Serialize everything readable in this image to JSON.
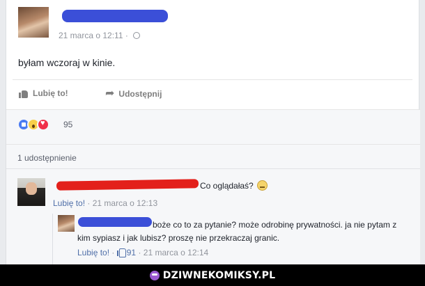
{
  "post": {
    "timestamp": "21 marca o 12:11",
    "text": "byłam wczoraj w kinie."
  },
  "actions": {
    "like_label": "Lubię to!",
    "share_label": "Udostępnij"
  },
  "reactions": {
    "types": [
      "like",
      "wow",
      "love"
    ],
    "count": "95"
  },
  "shares": {
    "text": "1 udostępnienie"
  },
  "comments": [
    {
      "text": "Co oglądałaś?",
      "like_label": "Lubię to!",
      "timestamp": "21 marca o 12:13"
    },
    {
      "text": "boże co to za pytanie? może odrobinę prywatności. ja nie pytam z kim sypiasz i jak lubisz? proszę nie przekraczaj granic.",
      "like_label": "Lubię to!",
      "like_count": "91",
      "timestamp": "21 marca o 12:14"
    }
  ],
  "footer": {
    "brand": "DZIWNEKOMIKSY.PL"
  },
  "colors": {
    "link": "#4f6fa8",
    "redaction_blue": "#3b4fd8",
    "redaction_red": "#e3201b"
  }
}
